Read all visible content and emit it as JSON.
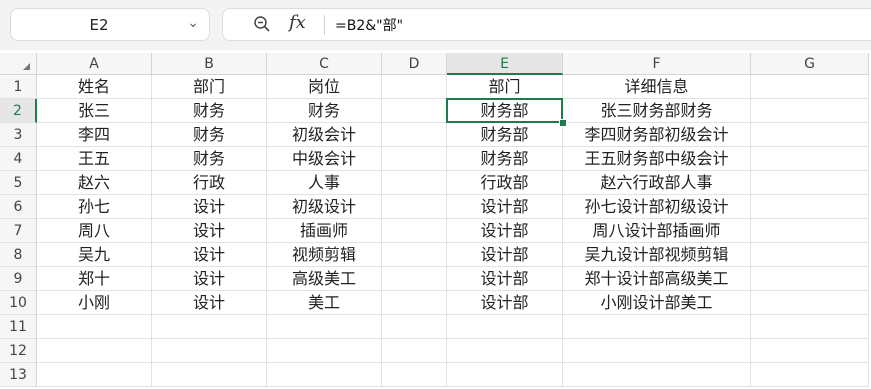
{
  "name_box": {
    "value": "E2"
  },
  "formula_bar": {
    "formula": "=B2&\"部\""
  },
  "columns": [
    "A",
    "B",
    "C",
    "D",
    "E",
    "F",
    "G"
  ],
  "rows": [
    "1",
    "2",
    "3",
    "4",
    "5",
    "6",
    "7",
    "8",
    "9",
    "10",
    "11",
    "12",
    "13"
  ],
  "selected": {
    "column": "E",
    "row": "2"
  },
  "cells": [
    [
      "姓名",
      "部门",
      "岗位",
      "",
      "部门",
      "详细信息",
      ""
    ],
    [
      "张三",
      "财务",
      "财务",
      "",
      "财务部",
      "张三财务部财务",
      ""
    ],
    [
      "李四",
      "财务",
      "初级会计",
      "",
      "财务部",
      "李四财务部初级会计",
      ""
    ],
    [
      "王五",
      "财务",
      "中级会计",
      "",
      "财务部",
      "王五财务部中级会计",
      ""
    ],
    [
      "赵六",
      "行政",
      "人事",
      "",
      "行政部",
      "赵六行政部人事",
      ""
    ],
    [
      "孙七",
      "设计",
      "初级设计",
      "",
      "设计部",
      "孙七设计部初级设计",
      ""
    ],
    [
      "周八",
      "设计",
      "插画师",
      "",
      "设计部",
      "周八设计部插画师",
      ""
    ],
    [
      "吴九",
      "设计",
      "视频剪辑",
      "",
      "设计部",
      "吴九设计部视频剪辑",
      ""
    ],
    [
      "郑十",
      "设计",
      "高级美工",
      "",
      "设计部",
      "郑十设计部高级美工",
      ""
    ],
    [
      "小刚",
      "设计",
      "美工",
      "",
      "设计部",
      "小刚设计部美工",
      ""
    ],
    [
      "",
      "",
      "",
      "",
      "",
      "",
      ""
    ],
    [
      "",
      "",
      "",
      "",
      "",
      "",
      ""
    ],
    [
      "",
      "",
      "",
      "",
      "",
      "",
      ""
    ]
  ]
}
